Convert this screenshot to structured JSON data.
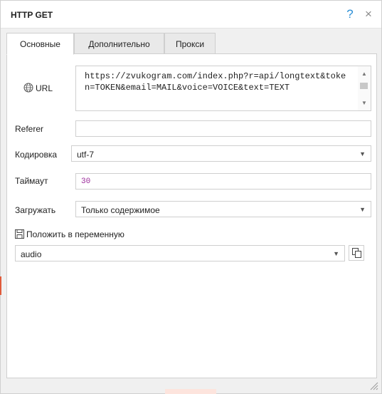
{
  "window": {
    "title": "HTTP GET",
    "help": "?",
    "close": "×"
  },
  "tabs": [
    {
      "label": "Основные",
      "active": true
    },
    {
      "label": "Дополнительно",
      "active": false
    },
    {
      "label": "Прокси",
      "active": false
    }
  ],
  "url": {
    "label": "URL",
    "value": "https://zvukogram.com/index.php?r=api/longtext&token=TOKEN&email=MAIL&voice=VOICE&text=TEXT"
  },
  "referer": {
    "label": "Referer",
    "value": ""
  },
  "encoding": {
    "label": "Кодировка",
    "value": "utf-7"
  },
  "timeout": {
    "label": "Таймаут",
    "value": "30"
  },
  "load": {
    "label": "Загружать",
    "value": "Только содержимое"
  },
  "save": {
    "label": "Положить в переменную",
    "value": "audio"
  },
  "colors": {
    "accent": "#2b8fd6",
    "timeout_value": "#9b2b9b"
  }
}
